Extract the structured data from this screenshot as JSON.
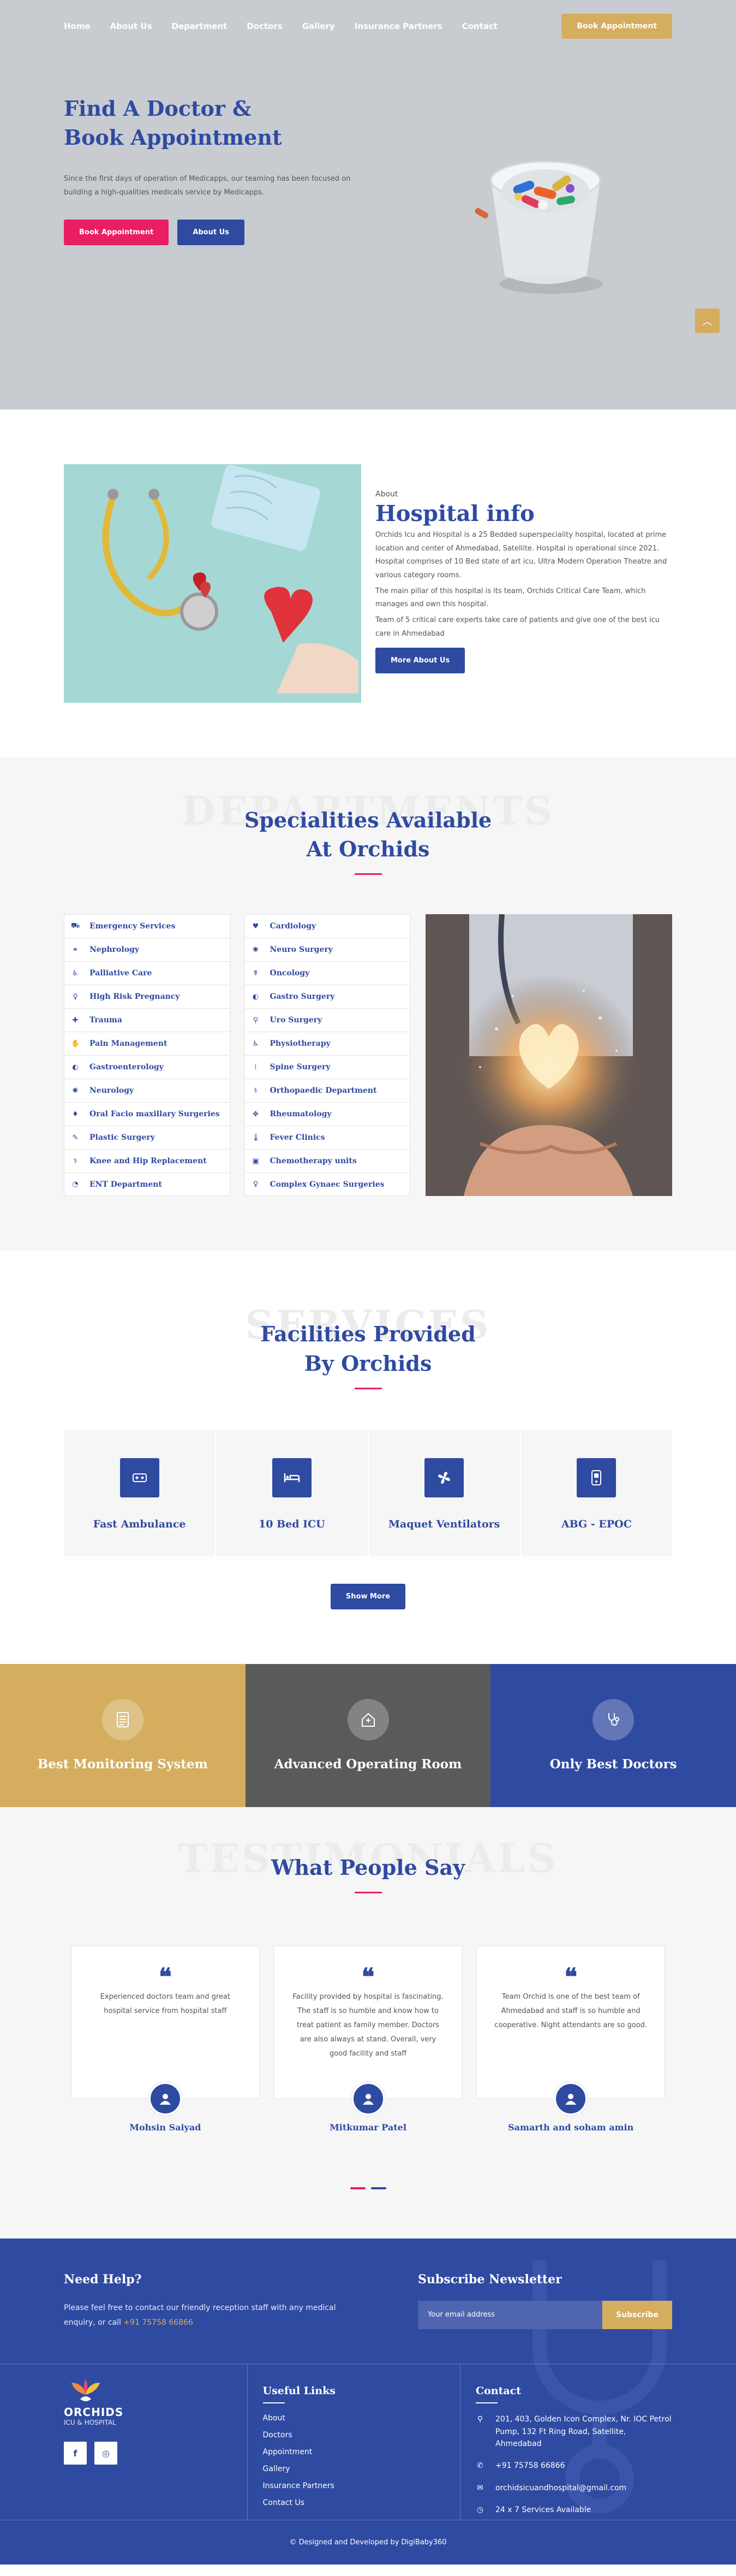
{
  "nav": {
    "items": [
      "Home",
      "About Us",
      "Department",
      "Doctors",
      "Gallery",
      "Insurance Partners",
      "Contact"
    ],
    "cta": "Book Appointment"
  },
  "hero": {
    "title": "Find A Doctor & Book Appointment",
    "text": "Since the first days of operation of Medicapps, our teaming has been focused on building a high-qualities medicals service by Medicapps.",
    "btn_primary": "Book Appointment",
    "btn_secondary": "About Us",
    "scroll_icon": "chevron-up-icon"
  },
  "about": {
    "tag": "About",
    "title": "Hospital info",
    "p1": "Orchids Icu and Hospital is a 25 Bedded superspeciality hospital, located at prime location and center of Ahmedabad, Satellite. Hospital is operational since 2021. Hospital comprises of 10 Bed state of art icu, Ultra Modern Operation Theatre and various category rooms.",
    "p2": "The main pillar of this hospital is its team, Orchids Critical Care Team, which manages and own this hospital.",
    "p3": "Team of 5 critical care experts take care of patients and give one of the best icu care in Ahmedabad",
    "btn": "More About Us"
  },
  "specialities": {
    "bg_word": "DEPARTMENTS",
    "title": "Specialities Available At Orchids",
    "col1": [
      {
        "label": "Emergency Services",
        "icon": "ambulance-icon",
        "glyph": "⛟"
      },
      {
        "label": "Nephrology",
        "icon": "kidney-icon",
        "glyph": "⚭"
      },
      {
        "label": "Palliative Care",
        "icon": "user-care-icon",
        "glyph": "♿"
      },
      {
        "label": "High Risk Pregnancy",
        "icon": "pregnancy-icon",
        "glyph": "♀"
      },
      {
        "label": "Trauma",
        "icon": "bandage-icon",
        "glyph": "✚"
      },
      {
        "label": "Pain Management",
        "icon": "hand-icon",
        "glyph": "✋"
      },
      {
        "label": "Gastroenterology",
        "icon": "stomach-icon",
        "glyph": "◐"
      },
      {
        "label": "Neurology",
        "icon": "brain-icon",
        "glyph": "✺"
      },
      {
        "label": "Oral Facio maxillary Surgeries",
        "icon": "tooth-icon",
        "glyph": "♦"
      },
      {
        "label": "Plastic Surgery",
        "icon": "syringe-icon",
        "glyph": "✎"
      },
      {
        "label": "Knee and Hip Replacement",
        "icon": "bone-icon",
        "glyph": "⚕"
      },
      {
        "label": "ENT Department",
        "icon": "ear-icon",
        "glyph": "◔"
      }
    ],
    "col2": [
      {
        "label": "Cardiology",
        "icon": "heart-icon",
        "glyph": "♥"
      },
      {
        "label": "Neuro Surgery",
        "icon": "brain-icon",
        "glyph": "✺"
      },
      {
        "label": "Oncology",
        "icon": "ribbon-icon",
        "glyph": "☤"
      },
      {
        "label": "Gastro Surgery",
        "icon": "stomach-icon",
        "glyph": "◐"
      },
      {
        "label": "Uro Surgery",
        "icon": "urology-icon",
        "glyph": "⚲"
      },
      {
        "label": "Physiotherapy",
        "icon": "wheelchair-icon",
        "glyph": "♿"
      },
      {
        "label": "Spine Surgery",
        "icon": "spine-icon",
        "glyph": "⁞"
      },
      {
        "label": "Orthopaedic Department",
        "icon": "bone-icon",
        "glyph": "⚕"
      },
      {
        "label": "Rheumatology",
        "icon": "joint-icon",
        "glyph": "✥"
      },
      {
        "label": "Fever Clinics",
        "icon": "thermometer-icon",
        "glyph": "🌡"
      },
      {
        "label": "Chemotherapy units",
        "icon": "iv-bag-icon",
        "glyph": "▣"
      },
      {
        "label": "Complex Gynaec Surgeries",
        "icon": "female-icon",
        "glyph": "♀"
      }
    ]
  },
  "facilities": {
    "bg_word": "SERVICES",
    "title": "Facilities Provided By Orchids",
    "items": [
      {
        "label": "Fast Ambulance",
        "icon": "ambulance-icon"
      },
      {
        "label": "10 Bed ICU",
        "icon": "bed-icon"
      },
      {
        "label": "Maquet Ventilators",
        "icon": "fan-icon"
      },
      {
        "label": "ABG - EPOC",
        "icon": "device-icon"
      }
    ],
    "btn": "Show More"
  },
  "strip": {
    "items": [
      {
        "label": "Best Monitoring System",
        "icon": "clipboard-icon",
        "color": "#d4ae5e"
      },
      {
        "label": "Advanced Operating Room",
        "icon": "hospital-icon",
        "color": "#5a5a5a"
      },
      {
        "label": "Only Best Doctors",
        "icon": "stethoscope-icon",
        "color": "#2f4aa1"
      }
    ]
  },
  "testimonials": {
    "bg_word": "TESTIMONIALS",
    "title": "What People Say",
    "items": [
      {
        "text": "Experienced doctors team and great hospital service from hospital staff",
        "name": "Mohsin Saiyad"
      },
      {
        "text": "Facility provided by hospital is fascinating. The staff is so humble and know how to treat patient as family member. Doctors are also always at stand. Overall, very good facility and staff",
        "name": "Mitkumar Patel"
      },
      {
        "text": "Team Orchid is one of the best team of Ahmedabad and staff is so humble and cooperative. Night attendants are so good.",
        "name": "Samarth and soham amin"
      }
    ]
  },
  "footer": {
    "help_title": "Need Help?",
    "help_text": "Please feel free to contact our friendly reception staff with any medical enquiry, or call",
    "help_phone": "+91 75758 66866",
    "news_title": "Subscribe Newsletter",
    "news_placeholder": "Your email address",
    "news_btn": "Subscribe",
    "logo_name": "ORCHIDS",
    "logo_sub": "ICU & HOSPITAL",
    "links_title": "Useful Links",
    "links": [
      "About",
      "Doctors",
      "Appointment",
      "Gallery",
      "Insurance Partners",
      "Contact Us"
    ],
    "contact_title": "Contact",
    "contact": [
      {
        "icon": "map-pin-icon",
        "text": "201, 403, Golden Icon Complex, Nr. IOC Petrol Pump, 132 Ft Ring Road, Satellite, Ahmedabad"
      },
      {
        "icon": "phone-icon",
        "text": "+91 75758 66866"
      },
      {
        "icon": "mail-icon",
        "text": "orchidsicuandhospital@gmail.com"
      },
      {
        "icon": "clock-icon",
        "text": "24 x 7 Services Available"
      }
    ],
    "credit": "© Designed and Developed by DigiBaby360"
  }
}
